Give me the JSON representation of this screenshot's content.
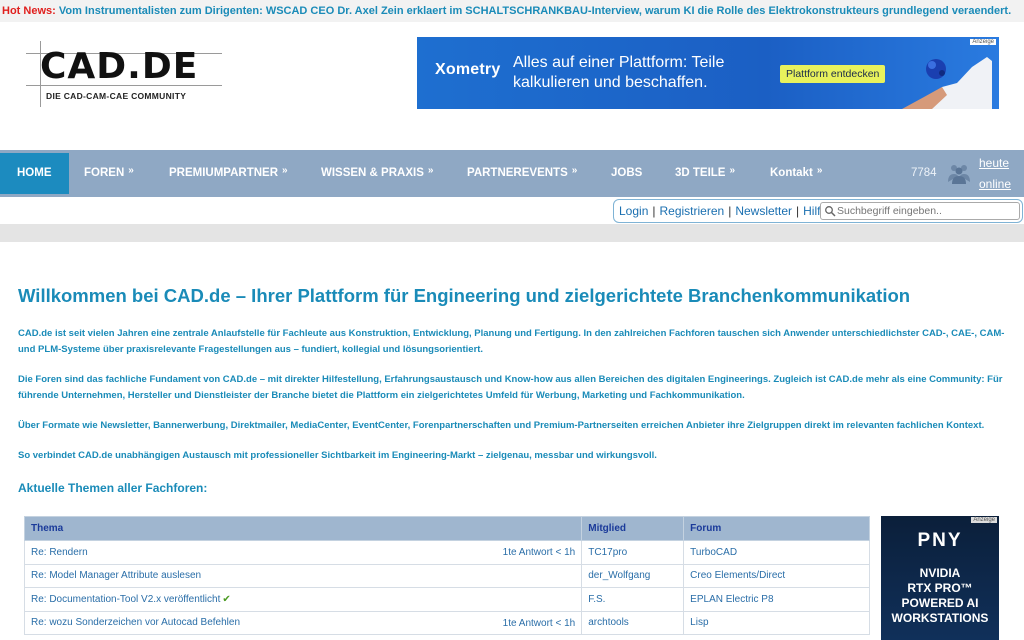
{
  "hotnews": {
    "label": "Hot News:",
    "text": "Vom Instrumentalisten zum Dirigenten: WSCAD CEO Dr. Axel Zein erklaert im SCHALTSCHRANKBAU-Interview, warum KI die Rolle des Elektrokonstrukteurs grundlegend veraendert."
  },
  "logo": {
    "main": "CAD.DE",
    "sub": "DIE CAD-CAM-CAE COMMUNITY"
  },
  "banner": {
    "brand": "Xometry",
    "title": "Alles auf einer Plattform: Teile kalkulieren und beschaffen.",
    "cta": "Plattform entdecken",
    "ad_label": "Anzeige"
  },
  "nav": {
    "items": [
      {
        "label": "HOME"
      },
      {
        "label": "FOREN",
        "chevron": "»"
      },
      {
        "label": "PREMIUMPARTNER",
        "chevron": "»"
      },
      {
        "label": "WISSEN & PRAXIS",
        "chevron": "»"
      },
      {
        "label": "PARTNEREVENTS",
        "chevron": "»"
      },
      {
        "label": "JOBS"
      },
      {
        "label": "3D TEILE",
        "chevron": "»"
      },
      {
        "label": "Kontakt",
        "chevron": "»"
      }
    ],
    "online_count": "7784",
    "online_link_1": "heute",
    "online_link_2": "online"
  },
  "userbar": {
    "login": "Login",
    "register": "Registrieren",
    "newsletter": "Newsletter",
    "help": "Hilfe",
    "sep": "|",
    "search_placeholder": "Suchbegriff eingeben.."
  },
  "main": {
    "title": "Willkommen bei CAD.de – Ihrer Plattform für Engineering und zielgerichtete Branchenkommunikation",
    "p1": "CAD.de ist seit vielen Jahren eine zentrale Anlaufstelle für Fachleute aus Konstruktion, Entwicklung, Planung und Fertigung. In den zahlreichen Fachforen tauschen sich Anwender unterschiedlichster CAD-, CAE-, CAM- und PLM-Systeme über praxisrelevante Fragestellungen aus – fundiert, kollegial und lösungsorientiert.",
    "p2": "Die Foren sind das fachliche Fundament von CAD.de – mit direkter Hilfestellung, Erfahrungsaustausch und Know-how aus allen Bereichen des digitalen Engineerings. Zugleich ist CAD.de mehr als eine Community: Für führende Unternehmen, Hersteller und Dienstleister der Branche bietet die Plattform ein zielgerichtetes Umfeld für Werbung, Marketing und Fachkommunikation.",
    "p3": "Über Formate wie Newsletter, Bannerwerbung, Direktmailer, MediaCenter, EventCenter, Forenpartnerschaften und Premium-Partnerseiten erreichen Anbieter ihre Zielgruppen direkt im relevanten fachlichen Kontext.",
    "p4": "So verbindet CAD.de unabhängigen Austausch mit professioneller Sichtbarkeit im Engineering-Markt – zielgenau, messbar und wirkungsvoll.",
    "section_title": "Aktuelle Themen aller Fachforen:"
  },
  "forum_table": {
    "headers": [
      "Thema",
      "Mitglied",
      "Forum"
    ],
    "rows": [
      {
        "topic": "Re: Rendern",
        "answers": "1te Antwort < 1h",
        "member": "TC17pro",
        "forum": "TurboCAD"
      },
      {
        "topic": "Re: Model Manager Attribute auslesen",
        "answers": "",
        "member": "der_Wolfgang",
        "forum": "Creo Elements/Direct"
      },
      {
        "topic": "Re: Documentation-Tool V2.x veröffentlicht",
        "answers": "",
        "member": "F.S.",
        "forum": "EPLAN Electric P8",
        "solved": "✔"
      },
      {
        "topic": "Re: wozu Sonderzeichen vor Autocad Befehlen",
        "answers": "1te Antwort < 1h",
        "member": "archtools",
        "forum": "Lisp"
      }
    ]
  },
  "side_ad": {
    "tag": "Anzeige",
    "brand": "PNY",
    "line1": "NVIDIA",
    "line2": "RTX PRO™",
    "line3": "POWERED AI",
    "line4": "WORKSTATIONS"
  }
}
